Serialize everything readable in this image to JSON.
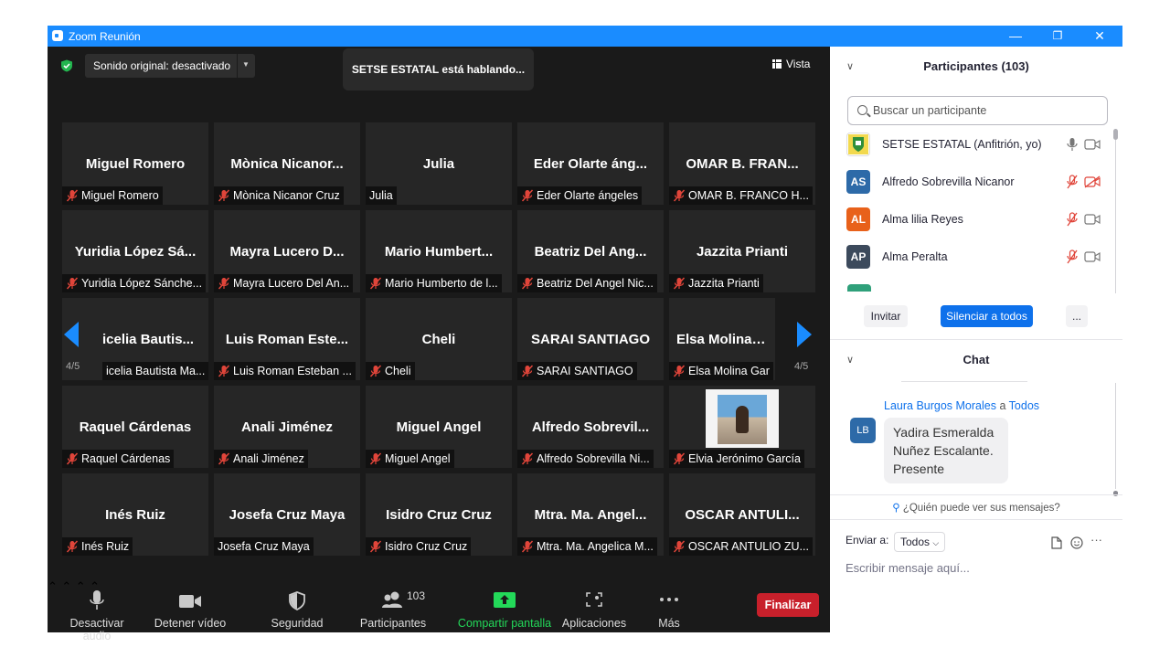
{
  "window": {
    "title": "Zoom Reunión",
    "minimize": "—",
    "restore": "❐",
    "close": "✕"
  },
  "meeting": {
    "sound_pill": "Sonido original: desactivado",
    "speaking_banner": "SETSE ESTATAL está hablando...",
    "view_label": "Vista",
    "page_left": "4/5",
    "page_right": "4/5",
    "tiles": [
      {
        "name": "Miguel Romero",
        "label": "Miguel Romero",
        "muted": true
      },
      {
        "name": "Mònica Nicanor...",
        "label": "Mònica Nicanor Cruz",
        "muted": true
      },
      {
        "name": "Julia",
        "label": "Julia",
        "muted": false
      },
      {
        "name": "Eder Olarte áng...",
        "label": "Eder Olarte ángeles",
        "muted": true
      },
      {
        "name": "OMAR B. FRAN...",
        "label": "OMAR B. FRANCO H...",
        "muted": true
      },
      {
        "name": "Yuridia López Sá...",
        "label": "Yuridia López Sánche...",
        "muted": true
      },
      {
        "name": "Mayra Lucero D...",
        "label": "Mayra Lucero Del An...",
        "muted": true
      },
      {
        "name": "Mario Humbert...",
        "label": "Mario Humberto de l...",
        "muted": true
      },
      {
        "name": "Beatriz Del Ang...",
        "label": "Beatriz Del Angel Nic...",
        "muted": true
      },
      {
        "name": "Jazzita Prianti",
        "label": "Jazzita Prianti",
        "muted": true
      },
      {
        "name": "icelia Bautis...",
        "label": "icelia Bautista Ma...",
        "muted": false
      },
      {
        "name": "Luis Roman Este...",
        "label": "Luis Roman Esteban ...",
        "muted": true
      },
      {
        "name": "Cheli",
        "label": "Cheli",
        "muted": true
      },
      {
        "name": "SARAI SANTIAGO",
        "label": "SARAI SANTIAGO",
        "muted": true
      },
      {
        "name": "Elsa Molina Ga",
        "label": "Elsa Molina Gar",
        "muted": true
      },
      {
        "name": "Raquel Cárdenas",
        "label": "Raquel Cárdenas",
        "muted": true
      },
      {
        "name": "Anali Jiménez",
        "label": "Anali Jiménez",
        "muted": true
      },
      {
        "name": "Miguel Angel",
        "label": "Miguel Angel",
        "muted": true
      },
      {
        "name": "Alfredo Sobrevil...",
        "label": "Alfredo Sobrevilla Ni...",
        "muted": true
      },
      {
        "name": "",
        "label": "Elvia Jerónimo García",
        "muted": true
      },
      {
        "name": "Inés Ruiz",
        "label": "Inés Ruiz",
        "muted": true
      },
      {
        "name": "Josefa Cruz Maya",
        "label": "Josefa Cruz Maya",
        "muted": false
      },
      {
        "name": "Isidro Cruz Cruz",
        "label": "Isidro Cruz Cruz",
        "muted": true
      },
      {
        "name": "Mtra. Ma. Angel...",
        "label": "Mtra. Ma. Angelica M...",
        "muted": true
      },
      {
        "name": "OSCAR ANTULI...",
        "label": "OSCAR ANTULIO ZU...",
        "muted": true
      }
    ]
  },
  "toolbar": {
    "audio": "Desactivar audio",
    "video": "Detener vídeo",
    "security": "Seguridad",
    "participants": "Participantes",
    "participants_count": "103",
    "share": "Compartir pantalla",
    "apps": "Aplicaciones",
    "more": "Más",
    "end": "Finalizar"
  },
  "participants_panel": {
    "title": "Participantes (103)",
    "search_placeholder": "Buscar un participante",
    "list": [
      {
        "initials": "",
        "name": "SETSE ESTATAL (Anfitrión, yo)",
        "color": "#f2d94e"
      },
      {
        "initials": "AS",
        "name": "Alfredo Sobrevilla Nicanor",
        "color": "#2d6aa8"
      },
      {
        "initials": "AL",
        "name": "Alma lilia Reyes",
        "color": "#e8611a"
      },
      {
        "initials": "AP",
        "name": "Alma Peralta",
        "color": "#3c4a5c"
      }
    ],
    "invite": "Invitar",
    "mute_all": "Silenciar a todos",
    "more": "..."
  },
  "chat": {
    "title": "Chat",
    "sender": "Laura Burgos Morales",
    "to_word": "a",
    "recipient": "Todos",
    "sender_initials": "LB",
    "message": "Yadira Esmeralda Nuñez Escalante. Presente",
    "who_can_see": "¿Quién puede ver sus mensajes?",
    "send_to_label": "Enviar a:",
    "send_to_value": "Todos",
    "input_placeholder": "Escribir mensaje aquí..."
  },
  "colors": {
    "accent": "#1a8cff",
    "end": "#c8202b",
    "share": "#23d959",
    "muted_red": "#e0453a"
  }
}
